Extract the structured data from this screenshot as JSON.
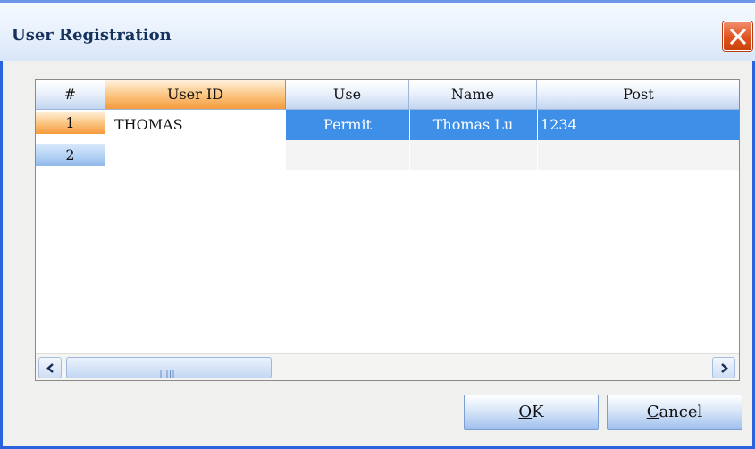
{
  "window": {
    "title": "User Registration"
  },
  "grid": {
    "columns": [
      "#",
      "User ID",
      "Use",
      "Name",
      "Post"
    ],
    "rows": [
      {
        "num": "1",
        "user_id": "THOMAS",
        "use": "Permit",
        "name": "Thomas Lu",
        "post": "1234"
      },
      {
        "num": "2",
        "user_id": "",
        "use": "",
        "name": "",
        "post": ""
      }
    ],
    "scrollbar_grip": "IIIII"
  },
  "buttons": {
    "ok_mnemonic": "O",
    "ok_rest": "K",
    "cancel_mnemonic": "C",
    "cancel_rest": "ancel"
  },
  "colors": {
    "selection": "#3e8fe7",
    "active_header": "#f59a3c",
    "title_close": "#e0531f"
  },
  "icons": {
    "close": "close-icon",
    "scroll_left": "chevron-left-icon",
    "scroll_right": "chevron-right-icon"
  }
}
